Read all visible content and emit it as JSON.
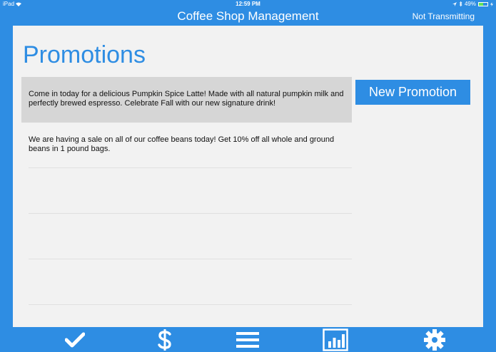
{
  "status_bar": {
    "device": "iPad",
    "time": "12:59 PM",
    "battery": "49%",
    "battery_level": 0.49
  },
  "nav": {
    "title": "Coffee Shop Management",
    "transmit_status": "Not Transmitting"
  },
  "page": {
    "title": "Promotions",
    "new_button_label": "New Promotion"
  },
  "promotions": [
    "Come in today for a delicious Pumpkin Spice Latte! Made with all natural pumpkin milk and perfectly brewed espresso. Celebrate Fall with our new signature drink!",
    "We are having a sale on all of our coffee beans today! Get 10% off all whole and ground beans in 1 pound bags."
  ],
  "tabbar": {
    "items": [
      "checkmark-icon",
      "dollar-icon",
      "menu-icon",
      "bar-chart-icon",
      "gear-icon"
    ]
  },
  "colors": {
    "accent": "#2e8de3",
    "background": "#f2f2f2",
    "selected_row": "#d6d6d6"
  }
}
